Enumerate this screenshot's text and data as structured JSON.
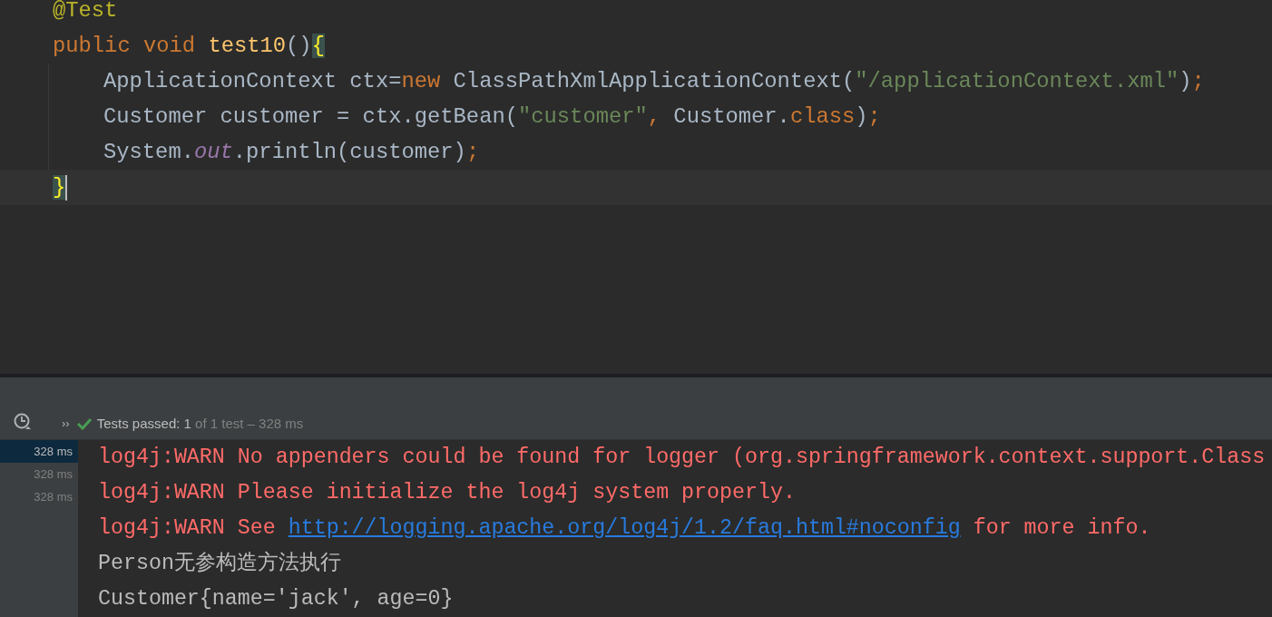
{
  "editor": {
    "lines": [
      {
        "caret": false,
        "tokens": [
          {
            "kind": "annotation",
            "text": "@Test"
          }
        ]
      },
      {
        "caret": false,
        "tokens": [
          {
            "kind": "keyword",
            "text": "public void "
          },
          {
            "kind": "method",
            "text": "test10"
          },
          {
            "kind": "plain",
            "text": "()"
          },
          {
            "kind": "brace",
            "text": "{"
          }
        ],
        "children": [
          {
            "caret": false,
            "tokens": [
              {
                "kind": "plain",
                "text": "ApplicationContext ctx="
              },
              {
                "kind": "keyword",
                "text": "new "
              },
              {
                "kind": "plain",
                "text": "ClassPathXmlApplicationContext("
              },
              {
                "kind": "string",
                "text": "\"/applicationContext.xml\""
              },
              {
                "kind": "plain",
                "text": ")"
              },
              {
                "kind": "keyword",
                "text": ";"
              }
            ]
          },
          {
            "caret": false,
            "tokens": [
              {
                "kind": "plain",
                "text": "Customer customer = ctx.getBean("
              },
              {
                "kind": "string",
                "text": "\"customer\""
              },
              {
                "kind": "keyword",
                "text": ", "
              },
              {
                "kind": "plain",
                "text": "Customer."
              },
              {
                "kind": "keyword",
                "text": "class"
              },
              {
                "kind": "plain",
                "text": ")"
              },
              {
                "kind": "keyword",
                "text": ";"
              }
            ]
          },
          {
            "caret": false,
            "tokens": [
              {
                "kind": "plain",
                "text": "System."
              },
              {
                "kind": "field",
                "text": "out"
              },
              {
                "kind": "plain",
                "text": ".println(customer)"
              },
              {
                "kind": "keyword",
                "text": ";"
              }
            ]
          }
        ]
      },
      {
        "caret": true,
        "tokens": [
          {
            "kind": "brace",
            "text": "}"
          }
        ]
      }
    ]
  },
  "run_panel": {
    "expand": "››",
    "status": [
      {
        "kind": "label",
        "text": "Tests passed: "
      },
      {
        "kind": "count",
        "text": "1"
      },
      {
        "kind": "detail",
        "text": " of 1 test – 328 ms"
      }
    ],
    "tests": [
      {
        "time": "328 ms",
        "selected": true
      },
      {
        "time": "328 ms",
        "selected": false
      },
      {
        "time": "328 ms",
        "selected": false
      }
    ],
    "console": [
      [
        {
          "kind": "error",
          "text": "log4j:WARN No appenders could be found for logger (org.springframework.context.support.Class"
        }
      ],
      [
        {
          "kind": "error",
          "text": "log4j:WARN Please initialize the log4j system properly."
        }
      ],
      [
        {
          "kind": "error",
          "text": "log4j:WARN See "
        },
        {
          "kind": "link",
          "text": "http://logging.apache.org/log4j/1.2/faq.html#noconfig"
        },
        {
          "kind": "error",
          "text": " for more info."
        }
      ],
      [
        {
          "kind": "output",
          "text": "Person无参构造方法执行"
        }
      ],
      [
        {
          "kind": "output",
          "text": "Customer{name='jack', age=0}"
        }
      ]
    ]
  }
}
